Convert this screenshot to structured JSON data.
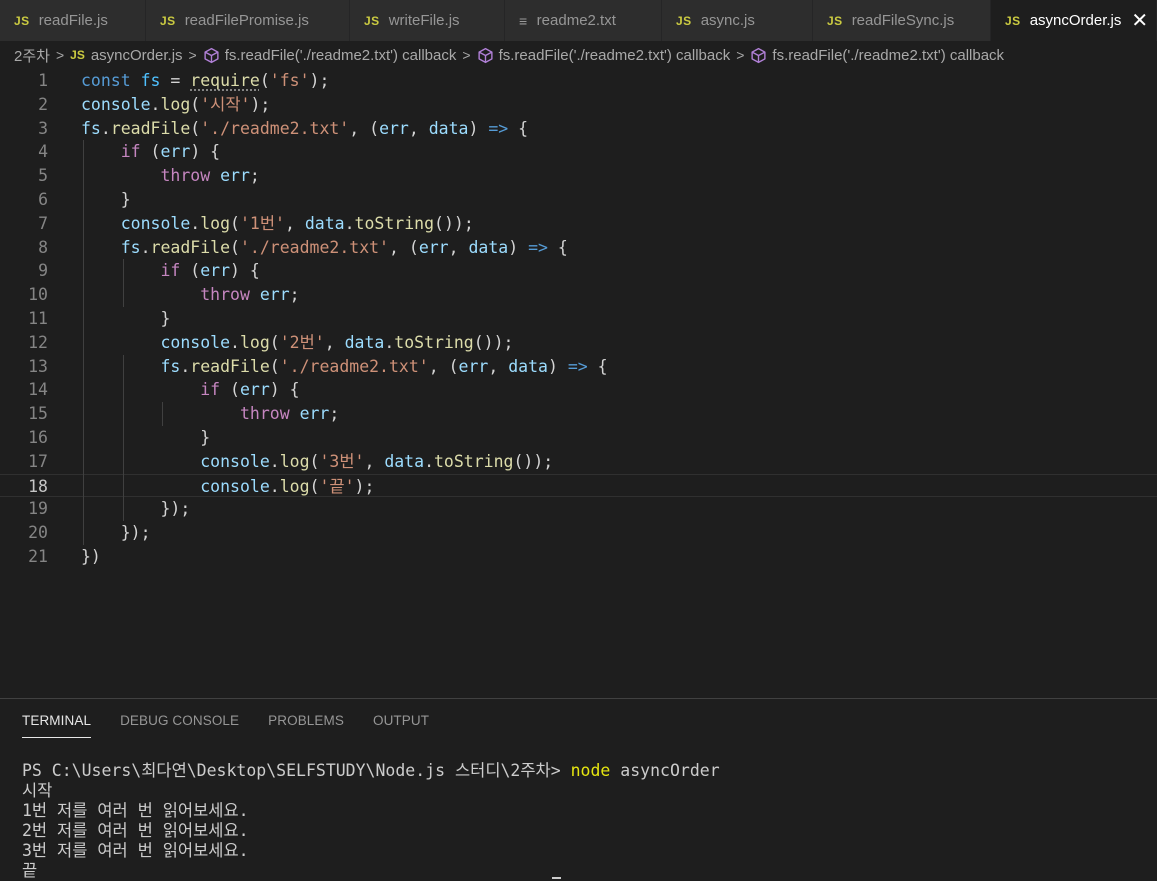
{
  "tabs": [
    {
      "label": "readFile.js",
      "icon": "JS",
      "width": 146
    },
    {
      "label": "readFilePromise.js",
      "icon": "JS",
      "width": 204
    },
    {
      "label": "writeFile.js",
      "icon": "JS",
      "width": 155
    },
    {
      "label": "readme2.txt",
      "icon": "≡",
      "width": 157
    },
    {
      "label": "async.js",
      "icon": "JS",
      "width": 151
    },
    {
      "label": "readFileSync.js",
      "icon": "JS",
      "width": 178
    },
    {
      "label": "asyncOrder.js",
      "icon": "JS",
      "width": 166,
      "active": true
    }
  ],
  "breadcrumb": {
    "folder": "2주차",
    "file": "asyncOrder.js",
    "symbols": [
      "fs.readFile('./readme2.txt') callback",
      "fs.readFile('./readme2.txt') callback",
      "fs.readFile('./readme2.txt') callback"
    ]
  },
  "editor": {
    "current_line": 18,
    "lines": [
      [
        [
          "kw",
          "const "
        ],
        [
          "cst",
          "fs"
        ],
        [
          "plain",
          " = "
        ],
        [
          "fnsq",
          "require"
        ],
        [
          "plain",
          "("
        ],
        [
          "str",
          "'fs'"
        ],
        [
          "plain",
          ");"
        ]
      ],
      [
        [
          "id",
          "console"
        ],
        [
          "plain",
          "."
        ],
        [
          "fn",
          "log"
        ],
        [
          "plain",
          "("
        ],
        [
          "str",
          "'시작'"
        ],
        [
          "plain",
          ");"
        ]
      ],
      [
        [
          "id",
          "fs"
        ],
        [
          "plain",
          "."
        ],
        [
          "fn",
          "readFile"
        ],
        [
          "plain",
          "("
        ],
        [
          "str",
          "'./readme2.txt'"
        ],
        [
          "plain",
          ", ("
        ],
        [
          "id",
          "err"
        ],
        [
          "plain",
          ", "
        ],
        [
          "id",
          "data"
        ],
        [
          "plain",
          ") "
        ],
        [
          "kw",
          "=>"
        ],
        [
          "plain",
          " {"
        ]
      ],
      [
        [
          "plain",
          "    "
        ],
        [
          "ctl",
          "if"
        ],
        [
          "plain",
          " ("
        ],
        [
          "id",
          "err"
        ],
        [
          "plain",
          ") {"
        ]
      ],
      [
        [
          "plain",
          "        "
        ],
        [
          "ctl",
          "throw"
        ],
        [
          "plain",
          " "
        ],
        [
          "id",
          "err"
        ],
        [
          "plain",
          ";"
        ]
      ],
      [
        [
          "plain",
          "    }"
        ]
      ],
      [
        [
          "plain",
          "    "
        ],
        [
          "id",
          "console"
        ],
        [
          "plain",
          "."
        ],
        [
          "fn",
          "log"
        ],
        [
          "plain",
          "("
        ],
        [
          "str",
          "'1번'"
        ],
        [
          "plain",
          ", "
        ],
        [
          "id",
          "data"
        ],
        [
          "plain",
          "."
        ],
        [
          "fn",
          "toString"
        ],
        [
          "plain",
          "());"
        ]
      ],
      [
        [
          "plain",
          "    "
        ],
        [
          "id",
          "fs"
        ],
        [
          "plain",
          "."
        ],
        [
          "fn",
          "readFile"
        ],
        [
          "plain",
          "("
        ],
        [
          "str",
          "'./readme2.txt'"
        ],
        [
          "plain",
          ", ("
        ],
        [
          "id",
          "err"
        ],
        [
          "plain",
          ", "
        ],
        [
          "id",
          "data"
        ],
        [
          "plain",
          ") "
        ],
        [
          "kw",
          "=>"
        ],
        [
          "plain",
          " {"
        ]
      ],
      [
        [
          "plain",
          "        "
        ],
        [
          "ctl",
          "if"
        ],
        [
          "plain",
          " ("
        ],
        [
          "id",
          "err"
        ],
        [
          "plain",
          ") {"
        ]
      ],
      [
        [
          "plain",
          "            "
        ],
        [
          "ctl",
          "throw"
        ],
        [
          "plain",
          " "
        ],
        [
          "id",
          "err"
        ],
        [
          "plain",
          ";"
        ]
      ],
      [
        [
          "plain",
          "        }"
        ]
      ],
      [
        [
          "plain",
          "        "
        ],
        [
          "id",
          "console"
        ],
        [
          "plain",
          "."
        ],
        [
          "fn",
          "log"
        ],
        [
          "plain",
          "("
        ],
        [
          "str",
          "'2번'"
        ],
        [
          "plain",
          ", "
        ],
        [
          "id",
          "data"
        ],
        [
          "plain",
          "."
        ],
        [
          "fn",
          "toString"
        ],
        [
          "plain",
          "());"
        ]
      ],
      [
        [
          "plain",
          "        "
        ],
        [
          "id",
          "fs"
        ],
        [
          "plain",
          "."
        ],
        [
          "fn",
          "readFile"
        ],
        [
          "plain",
          "("
        ],
        [
          "str",
          "'./readme2.txt'"
        ],
        [
          "plain",
          ", ("
        ],
        [
          "id",
          "err"
        ],
        [
          "plain",
          ", "
        ],
        [
          "id",
          "data"
        ],
        [
          "plain",
          ") "
        ],
        [
          "kw",
          "=>"
        ],
        [
          "plain",
          " {"
        ]
      ],
      [
        [
          "plain",
          "            "
        ],
        [
          "ctl",
          "if"
        ],
        [
          "plain",
          " ("
        ],
        [
          "id",
          "err"
        ],
        [
          "plain",
          ") {"
        ]
      ],
      [
        [
          "plain",
          "                "
        ],
        [
          "ctl",
          "throw"
        ],
        [
          "plain",
          " "
        ],
        [
          "id",
          "err"
        ],
        [
          "plain",
          ";"
        ]
      ],
      [
        [
          "plain",
          "            }"
        ]
      ],
      [
        [
          "plain",
          "            "
        ],
        [
          "id",
          "console"
        ],
        [
          "plain",
          "."
        ],
        [
          "fn",
          "log"
        ],
        [
          "plain",
          "("
        ],
        [
          "str",
          "'3번'"
        ],
        [
          "plain",
          ", "
        ],
        [
          "id",
          "data"
        ],
        [
          "plain",
          "."
        ],
        [
          "fn",
          "toString"
        ],
        [
          "plain",
          "());"
        ]
      ],
      [
        [
          "plain",
          "            "
        ],
        [
          "id",
          "console"
        ],
        [
          "plain",
          "."
        ],
        [
          "fn",
          "log"
        ],
        [
          "plain",
          "("
        ],
        [
          "str",
          "'끝'"
        ],
        [
          "plain",
          ");"
        ]
      ],
      [
        [
          "plain",
          "        });"
        ]
      ],
      [
        [
          "plain",
          "    });"
        ]
      ],
      [
        [
          "plain",
          "})"
        ]
      ]
    ]
  },
  "panel": {
    "tabs": [
      {
        "label": "TERMINAL",
        "active": true
      },
      {
        "label": "DEBUG CONSOLE"
      },
      {
        "label": "PROBLEMS"
      },
      {
        "label": "OUTPUT"
      }
    ],
    "terminal": {
      "prompt": "PS C:\\Users\\최다연\\Desktop\\SELFSTUDY\\Node.js 스터디\\2주차> ",
      "command": "node",
      "args": " asyncOrder",
      "output": [
        "시작",
        "1번 저를 여러 번 읽어보세요.",
        "2번 저를 여러 번 읽어보세요.",
        "3번 저를 여러 번 읽어보세요.",
        "끝"
      ]
    }
  }
}
